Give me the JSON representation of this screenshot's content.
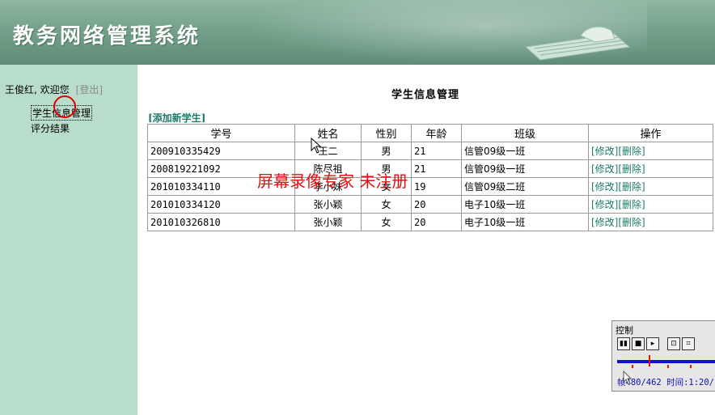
{
  "header": {
    "title": "教务网络管理系统"
  },
  "sidebar": {
    "welcome": "王俊红, 欢迎您",
    "logout": "[登出]",
    "items": [
      {
        "label": "学生信息管理"
      },
      {
        "label": "评分结果"
      }
    ]
  },
  "main": {
    "title": "学生信息管理",
    "add_link": "[添加新学生]",
    "columns": [
      "学号",
      "姓名",
      "性别",
      "年龄",
      "班级",
      "操作"
    ],
    "rows": [
      {
        "id": "200910335429",
        "name": "王二",
        "sex": "男",
        "age": "21",
        "class": "信管09级一班"
      },
      {
        "id": "200819221092",
        "name": "陈尽祖",
        "sex": "男",
        "age": "21",
        "class": "信管09级一班"
      },
      {
        "id": "201010334110",
        "name": "李小妹",
        "sex": "女",
        "age": "19",
        "class": "信管09级二班"
      },
      {
        "id": "201010334120",
        "name": "张小颖",
        "sex": "女",
        "age": "20",
        "class": "电子10级一班"
      },
      {
        "id": "201010326810",
        "name": "张小颖",
        "sex": "女",
        "age": "20",
        "class": "电子10级一班"
      }
    ],
    "edit_label": "[修改]",
    "delete_label": "[删除]"
  },
  "watermark": "屏幕录像专家 未注册",
  "control": {
    "title": "控制",
    "status": "帧480/462 时间:1:20/"
  },
  "colors": {
    "banner": "#6f9d86",
    "sidebar": "#b8ddcd",
    "link": "#1b7a6a",
    "watermark": "#e01010"
  }
}
